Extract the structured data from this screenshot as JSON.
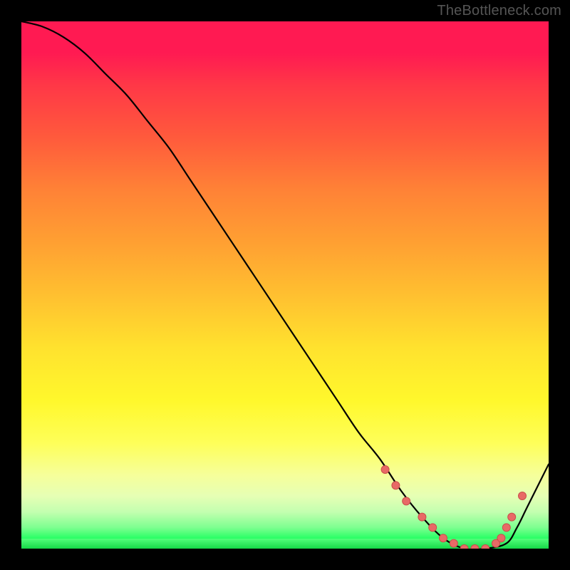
{
  "watermark": "TheBottleneck.com",
  "colors": {
    "background": "#000000",
    "curve": "#000000",
    "marker_fill": "#e86a66",
    "marker_stroke": "#c94f4b",
    "gradient_top": "#ff1a52",
    "gradient_bottom": "#17e24a"
  },
  "chart_data": {
    "type": "line",
    "title": "",
    "xlabel": "",
    "ylabel": "",
    "xlim": [
      0,
      100
    ],
    "ylim": [
      0,
      100
    ],
    "grid": false,
    "legend": false,
    "background_gradient": "vertical red→yellow→green",
    "series": [
      {
        "name": "bottleneck-curve",
        "x": [
          0,
          4,
          8,
          12,
          16,
          20,
          24,
          28,
          32,
          36,
          40,
          44,
          48,
          52,
          56,
          60,
          64,
          68,
          72,
          76,
          80,
          84,
          88,
          92,
          94,
          96,
          100
        ],
        "y": [
          100,
          99,
          97,
          94,
          90,
          86,
          81,
          76,
          70,
          64,
          58,
          52,
          46,
          40,
          34,
          28,
          22,
          17,
          11,
          6,
          2,
          0,
          0,
          1,
          4,
          8,
          16
        ]
      }
    ],
    "markers": {
      "name": "highlight-points",
      "x": [
        69,
        71,
        73,
        76,
        78,
        80,
        82,
        84,
        86,
        88,
        90,
        91,
        92,
        93,
        95
      ],
      "y": [
        15,
        12,
        9,
        6,
        4,
        2,
        1,
        0,
        0,
        0,
        1,
        2,
        4,
        6,
        10
      ]
    }
  }
}
